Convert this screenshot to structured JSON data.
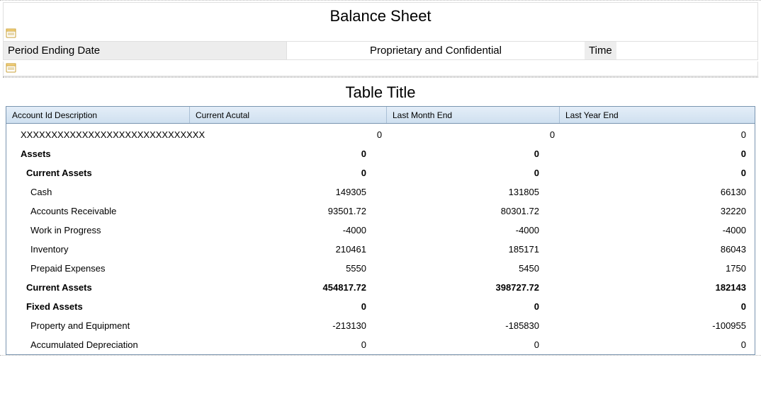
{
  "header": {
    "title": "Balance Sheet",
    "period_label": "Period Ending Date",
    "confidential": "Proprietary and Confidential",
    "time_label": "Time"
  },
  "table": {
    "title": "Table Title",
    "columns": {
      "c0": "Account Id Description",
      "c1": "Current Acutal",
      "c2": "Last Month End",
      "c3": "Last Year End"
    },
    "rows": [
      {
        "label": "XXXXXXXXXXXXXXXXXXXXXXXXXXXXXX",
        "v1": "0",
        "v2": "0",
        "v3": "0",
        "style": "indent-1"
      },
      {
        "label": "Assets",
        "v1": "0",
        "v2": "0",
        "v3": "0",
        "style": "bold indent-1"
      },
      {
        "label": "Current Assets",
        "v1": "0",
        "v2": "0",
        "v3": "0",
        "style": "bold indent-2"
      },
      {
        "label": "Cash",
        "v1": "149305",
        "v2": "131805",
        "v3": "66130",
        "style": "indent-3"
      },
      {
        "label": "Accounts Receivable",
        "v1": "93501.72",
        "v2": "80301.72",
        "v3": "32220",
        "style": "indent-3"
      },
      {
        "label": "Work in Progress",
        "v1": "-4000",
        "v2": "-4000",
        "v3": "-4000",
        "style": "indent-3"
      },
      {
        "label": "Inventory",
        "v1": "210461",
        "v2": "185171",
        "v3": "86043",
        "style": "indent-3"
      },
      {
        "label": "Prepaid Expenses",
        "v1": "5550",
        "v2": "5450",
        "v3": "1750",
        "style": "indent-3"
      },
      {
        "label": "Current Assets",
        "v1": "454817.72",
        "v2": "398727.72",
        "v3": "182143",
        "style": "bold indent-2"
      },
      {
        "label": "Fixed Assets",
        "v1": "0",
        "v2": "0",
        "v3": "0",
        "style": "bold indent-2"
      },
      {
        "label": "Property and Equipment",
        "v1": "-213130",
        "v2": "-185830",
        "v3": "-100955",
        "style": "indent-3"
      },
      {
        "label": "Accumulated Depreciation",
        "v1": "0",
        "v2": "0",
        "v3": "0",
        "style": "indent-3"
      }
    ]
  },
  "icons": {
    "note": "note-icon"
  }
}
